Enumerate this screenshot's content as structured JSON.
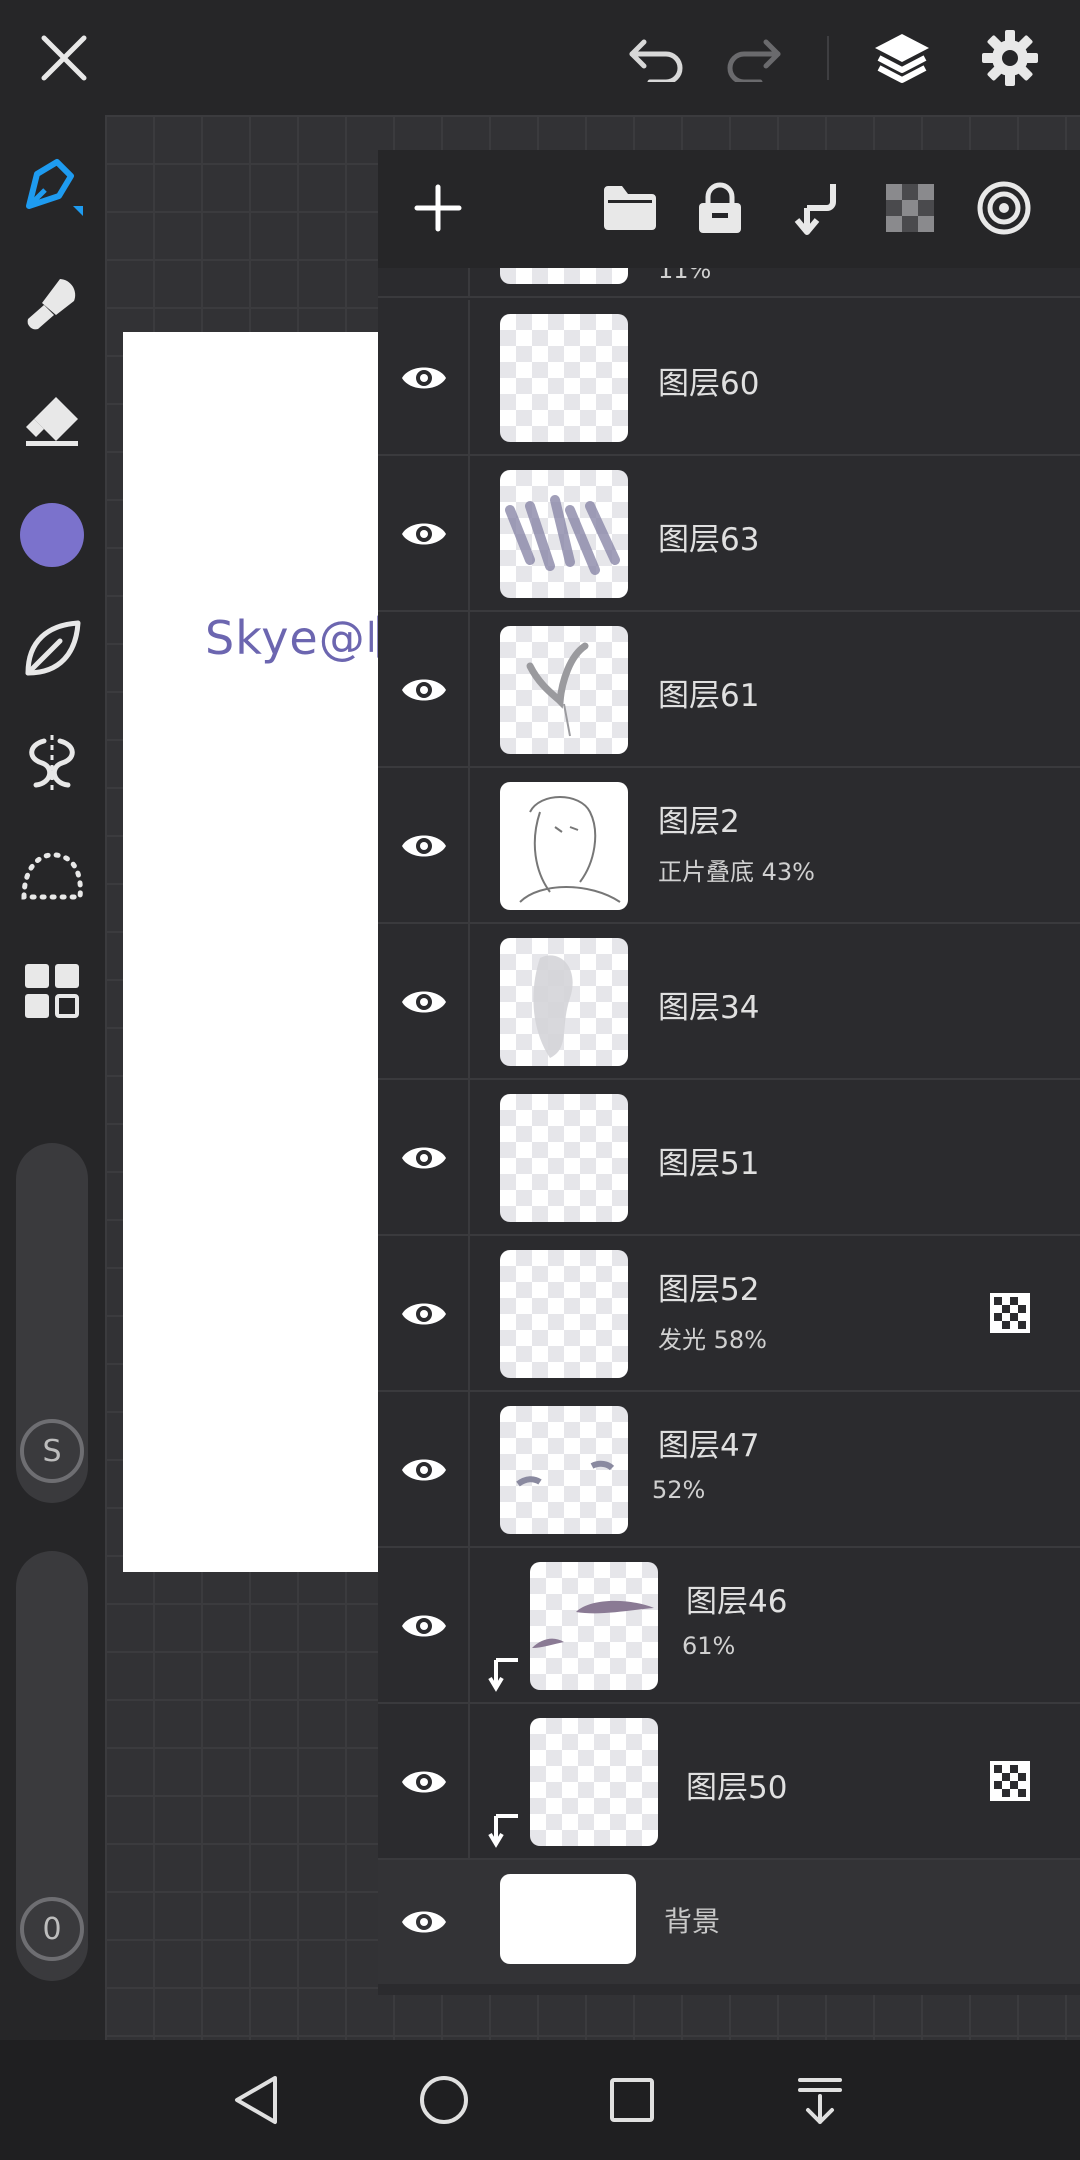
{
  "canvas": {
    "signature_text": "Skye@临"
  },
  "layers": [
    {
      "name": "",
      "sub": "11%",
      "thumb": "partial"
    },
    {
      "name": "图层60",
      "sub": "",
      "thumb": "empty"
    },
    {
      "name": "图层63",
      "sub": "",
      "thumb": "strokes"
    },
    {
      "name": "图层61",
      "sub": "",
      "thumb": "wings"
    },
    {
      "name": "图层2",
      "sub": "正片叠底  43%",
      "thumb": "sketch"
    },
    {
      "name": "图层34",
      "sub": "",
      "thumb": "shadow"
    },
    {
      "name": "图层51",
      "sub": "",
      "thumb": "empty"
    },
    {
      "name": "图层52",
      "sub": "发光  58%",
      "thumb": "empty",
      "alpha_lock": true
    },
    {
      "name": "图层47",
      "sub": "52%",
      "thumb": "marks"
    },
    {
      "name": "图层46",
      "sub": "61%",
      "thumb": "brows",
      "clipped": true
    },
    {
      "name": "图层50",
      "sub": "",
      "thumb": "faint",
      "clipped": true,
      "alpha_lock": true
    },
    {
      "name": "背景",
      "sub": "",
      "thumb": "white"
    }
  ],
  "colors": {
    "current_brush_color": "#7b72cc",
    "active_tool": "#1e9bf0"
  },
  "icons": {
    "top": [
      "close-icon",
      "undo-icon",
      "redo-icon",
      "layers-icon",
      "settings-icon"
    ],
    "tools": [
      "pen-icon",
      "smudge-icon",
      "eraser-icon",
      "color-swatch",
      "leaf-brush-icon",
      "symmetry-icon",
      "lasso-icon",
      "grid-menu-icon"
    ],
    "panel": [
      "add-layer-icon",
      "folder-icon",
      "lock-icon",
      "merge-down-icon",
      "alpha-lock-icon",
      "layer-effects-icon"
    ],
    "nav": [
      "back-icon",
      "home-icon",
      "recents-icon",
      "notification-icon"
    ]
  },
  "sliders": {
    "size_label": "S",
    "opacity_label": "0"
  }
}
